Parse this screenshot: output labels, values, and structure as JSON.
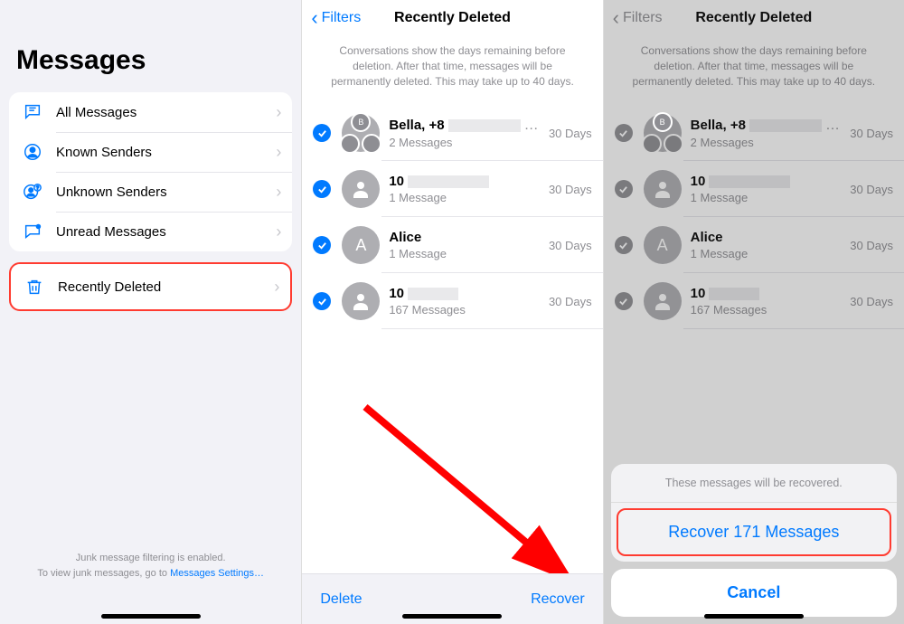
{
  "pane1": {
    "title": "Messages",
    "filters": [
      {
        "icon": "chat-bubble",
        "label": "All Messages"
      },
      {
        "icon": "person-circle",
        "label": "Known Senders"
      },
      {
        "icon": "person-question",
        "label": "Unknown Senders"
      },
      {
        "icon": "chat-dot",
        "label": "Unread Messages"
      }
    ],
    "deleted": {
      "icon": "trash",
      "label": "Recently Deleted"
    },
    "footer_line1": "Junk message filtering is enabled.",
    "footer_line2": "To view junk messages, go to ",
    "footer_link": "Messages Settings…"
  },
  "pane2": {
    "back": "Filters",
    "title": "Recently Deleted",
    "subtext": "Conversations show the days remaining before deletion. After that time, messages will be permanently deleted. This may take up to 40 days.",
    "items": [
      {
        "name": "Bella, +8",
        "redact_w": 80,
        "ell": true,
        "sub": "2 Messages",
        "days": "30 Days",
        "avatar": "group"
      },
      {
        "name": "10",
        "redact_w": 90,
        "ell": false,
        "sub": "1 Message",
        "days": "30 Days",
        "avatar": "person"
      },
      {
        "name": "Alice",
        "redact_w": 0,
        "ell": false,
        "sub": "1 Message",
        "days": "30 Days",
        "avatar": "A"
      },
      {
        "name": "10",
        "redact_w": 56,
        "ell": false,
        "sub": "167 Messages",
        "days": "30 Days",
        "avatar": "person"
      }
    ],
    "delete": "Delete",
    "recover": "Recover"
  },
  "pane3": {
    "back": "Filters",
    "title": "Recently Deleted",
    "subtext": "Conversations show the days remaining before deletion. After that time, messages will be permanently deleted. This may take up to 40 days.",
    "items": [
      {
        "name": "Bella, +8",
        "redact_w": 80,
        "ell": true,
        "sub": "2 Messages",
        "days": "30 Days",
        "avatar": "group"
      },
      {
        "name": "10",
        "redact_w": 90,
        "ell": false,
        "sub": "1 Message",
        "days": "30 Days",
        "avatar": "person"
      },
      {
        "name": "Alice",
        "redact_w": 0,
        "ell": false,
        "sub": "1 Message",
        "days": "30 Days",
        "avatar": "A"
      },
      {
        "name": "10",
        "redact_w": 56,
        "ell": false,
        "sub": "167 Messages",
        "days": "30 Days",
        "avatar": "person"
      }
    ],
    "sheet": {
      "text": "These messages will be recovered.",
      "action": "Recover 171 Messages",
      "cancel": "Cancel"
    }
  }
}
